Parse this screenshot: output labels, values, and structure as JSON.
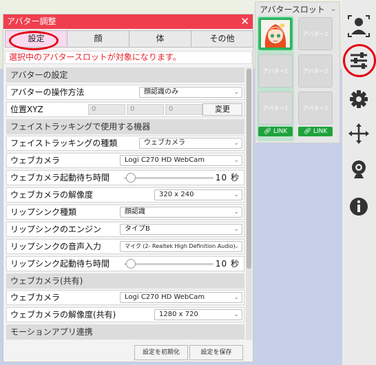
{
  "window": {
    "title": "アバター調整",
    "close_label": "✕",
    "tabs": [
      {
        "label": "設定"
      },
      {
        "label": "顔"
      },
      {
        "label": "体"
      },
      {
        "label": "その他"
      }
    ],
    "notice": "選択中のアバタースロットが対象になります。"
  },
  "form": {
    "section_avatar": "アバターの設定",
    "op_method_label": "アバターの操作方法",
    "op_method_value": "顔認識のみ",
    "pos_label": "位置XYZ",
    "pos_x": "0",
    "pos_y": "0",
    "pos_z": "0",
    "pos_change": "変更",
    "section_face": "フェイストラッキングで使用する機器",
    "ft_type_label": "フェイストラッキングの種類",
    "ft_type_value": "ウェブカメラ",
    "webcam_label": "ウェブカメラ",
    "webcam_value": "Logi C270 HD WebCam",
    "webcam_wait_label": "ウェブカメラ起動待ち時間",
    "webcam_wait_value": "10 秒",
    "webcam_wait_level": 0.08,
    "webcam_res_label": "ウェブカメラの解像度",
    "webcam_res_value": "320 x 240",
    "lip_type_label": "リップシンク種類",
    "lip_type_value": "顔認識",
    "lip_engine_label": "リップシンクのエンジン",
    "lip_engine_value": "タイプB",
    "lip_input_label": "リップシンクの音声入力",
    "lip_input_value": "マイク (2- Realtek High Definition Audio)",
    "lip_wait_label": "リップシンク起動待ち時間",
    "lip_wait_value": "10 秒",
    "lip_wait_level": 0.08,
    "section_shared": "ウェブカメラ(共有)",
    "shared_cam_label": "ウェブカメラ",
    "shared_cam_value": "Logi C270 HD WebCam",
    "shared_res_label": "ウェブカメラの解像度(共有)",
    "shared_res_value": "1280 x 720",
    "section_motion": "モーションアプリ連携"
  },
  "footer": {
    "reset_label": "設定を初期化",
    "save_label": "設定を保存"
  },
  "slots": {
    "title": "アバタースロット",
    "slot1_label": "アバター1",
    "slot2_label": "アバター2",
    "link_label": "LINK"
  },
  "toolbar": {
    "icons": [
      "person-icon",
      "sliders-icon",
      "gear-icon",
      "move-icon",
      "webcam-icon",
      "info-icon"
    ]
  },
  "colors": {
    "title_bar": "#ef3f4f",
    "active_tab": "#fbd9ef",
    "notice_text": "#e8202a",
    "highlight_ring": "#e40012",
    "link_green": "#1ea33c"
  }
}
